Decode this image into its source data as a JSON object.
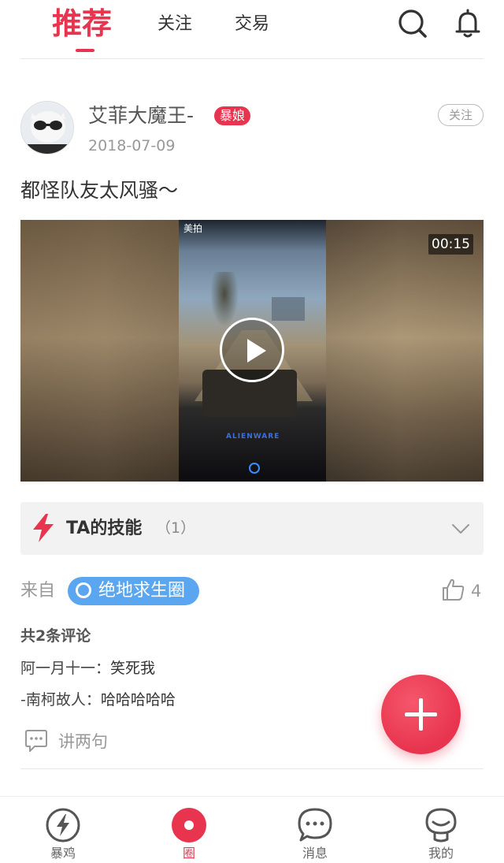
{
  "header": {
    "tabs": [
      {
        "label": "推荐",
        "active": true
      },
      {
        "label": "关注",
        "active": false
      },
      {
        "label": "交易",
        "active": false
      }
    ],
    "icons": [
      "search-icon",
      "bell-icon"
    ],
    "accent_color": "#e8344e"
  },
  "post": {
    "author": "艾菲大魔王-",
    "author_badge": "暴娘",
    "date": "2018-07-09",
    "follow_label": "关注",
    "text": "都怪队友太风骚～",
    "video": {
      "duration": "00:15",
      "overlay_top_text": "美拍",
      "brand_text": "ALIENWARE"
    },
    "skill": {
      "label": "TA的技能",
      "count": "（1）"
    },
    "from_label": "来自",
    "circle_tag": "绝地求生圈",
    "circle_color": "#5aa6f0",
    "like_count": "4",
    "comments_total": "共2条评论",
    "comments": [
      {
        "user": "阿一月十一：",
        "text": "笑死我"
      },
      {
        "user": "-南柯故人：",
        "text": "哈哈哈哈哈"
      }
    ],
    "reply_label": "讲两句"
  },
  "bottom_nav": [
    {
      "label": "暴鸡",
      "icon": "lightning-icon",
      "active": false
    },
    {
      "label": "圈",
      "icon": "circle-icon",
      "active": true
    },
    {
      "label": "消息",
      "icon": "chat-icon",
      "active": false
    },
    {
      "label": "我的",
      "icon": "profile-icon",
      "active": false
    }
  ]
}
